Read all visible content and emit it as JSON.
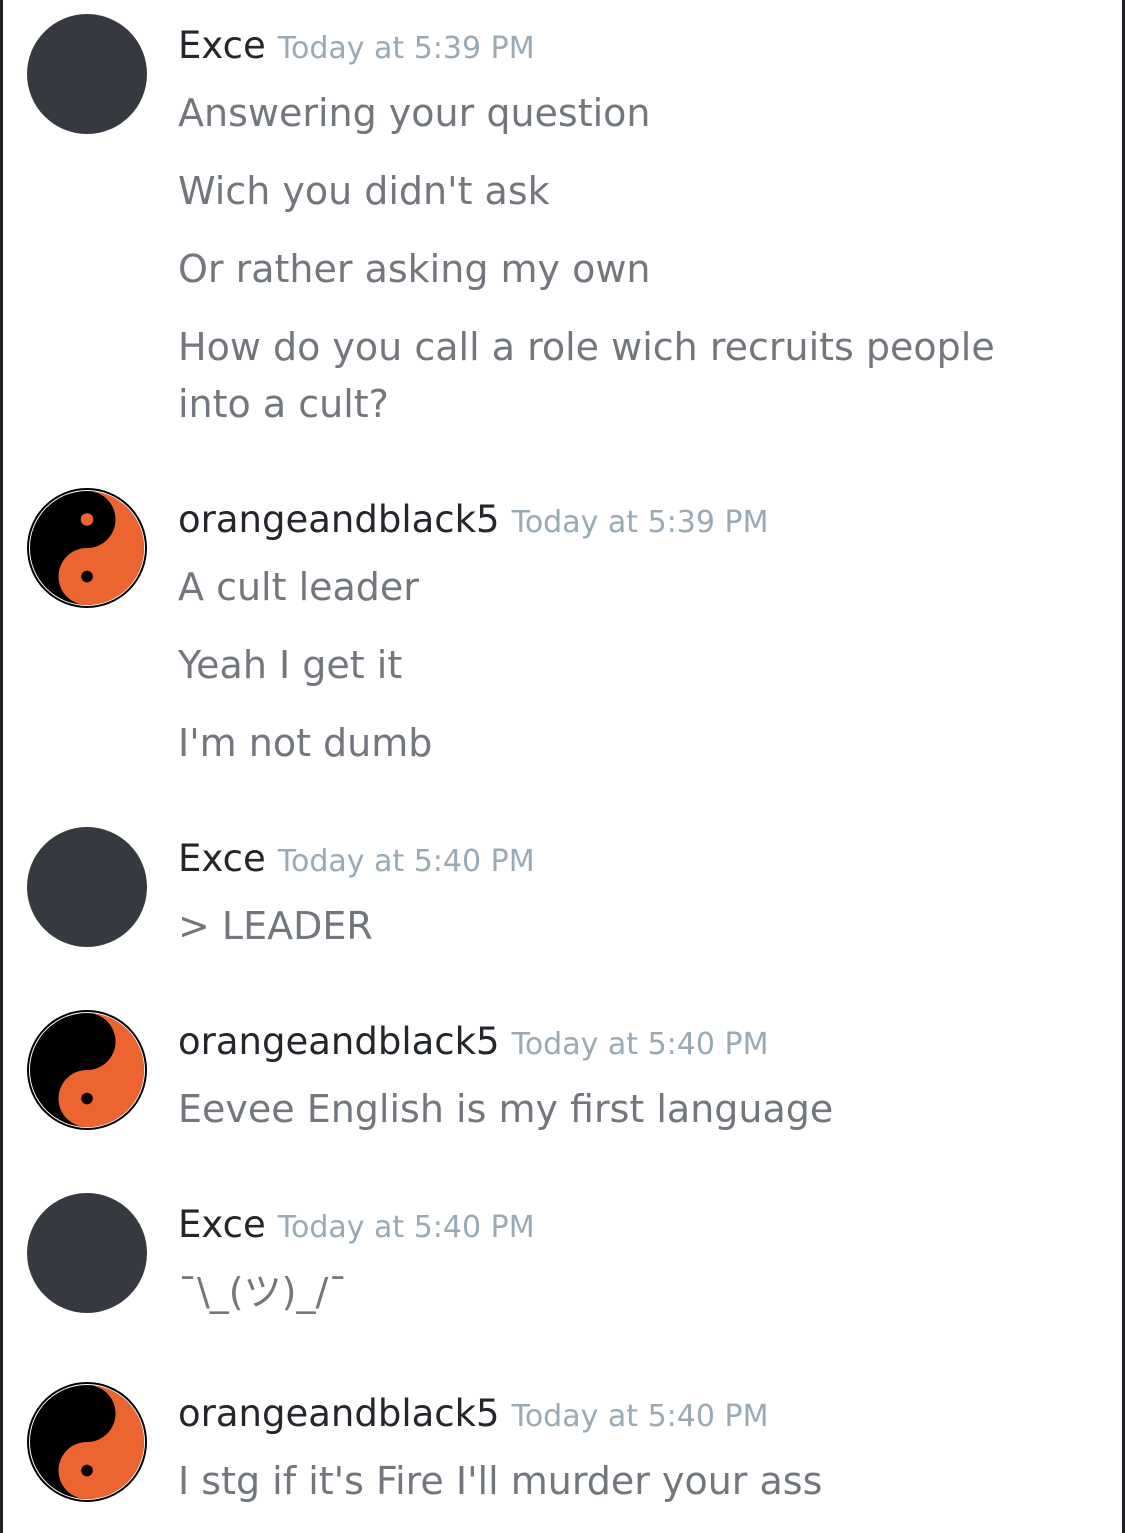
{
  "colors": {
    "username": "#23262a",
    "timestamp": "#99aab5",
    "message_text": "#72767d",
    "default_avatar": "#36393f",
    "yin_yang_orange": "#ec6530",
    "yin_yang_black": "#000000"
  },
  "messages": [
    {
      "author": "Exce",
      "avatar": "default-dark-avatar",
      "timestamp": "Today at 5:39 PM",
      "lines": [
        "Answering your question",
        "Wich you didn't ask",
        "Or rather asking my own",
        "How do you call a role wich recruits people into a cult?"
      ]
    },
    {
      "author": "orangeandblack5",
      "avatar": "yin-yang-avatar",
      "timestamp": "Today at 5:39 PM",
      "lines": [
        "A cult leader",
        "Yeah I get it",
        "I'm not dumb"
      ]
    },
    {
      "author": "Exce",
      "avatar": "default-dark-avatar",
      "timestamp": "Today at 5:40 PM",
      "lines": [
        "> LEADER"
      ]
    },
    {
      "author": "orangeandblack5",
      "avatar": "yin-yang-avatar",
      "timestamp": "Today at 5:40 PM",
      "lines": [
        "Eevee English is my first language"
      ]
    },
    {
      "author": "Exce",
      "avatar": "default-dark-avatar",
      "timestamp": "Today at 5:40 PM",
      "lines": [
        "¯\\_(ツ)_/¯"
      ]
    },
    {
      "author": "orangeandblack5",
      "avatar": "yin-yang-avatar",
      "timestamp": "Today at 5:40 PM",
      "lines": [
        "I stg if it's Fire I'll murder your ass"
      ]
    }
  ]
}
